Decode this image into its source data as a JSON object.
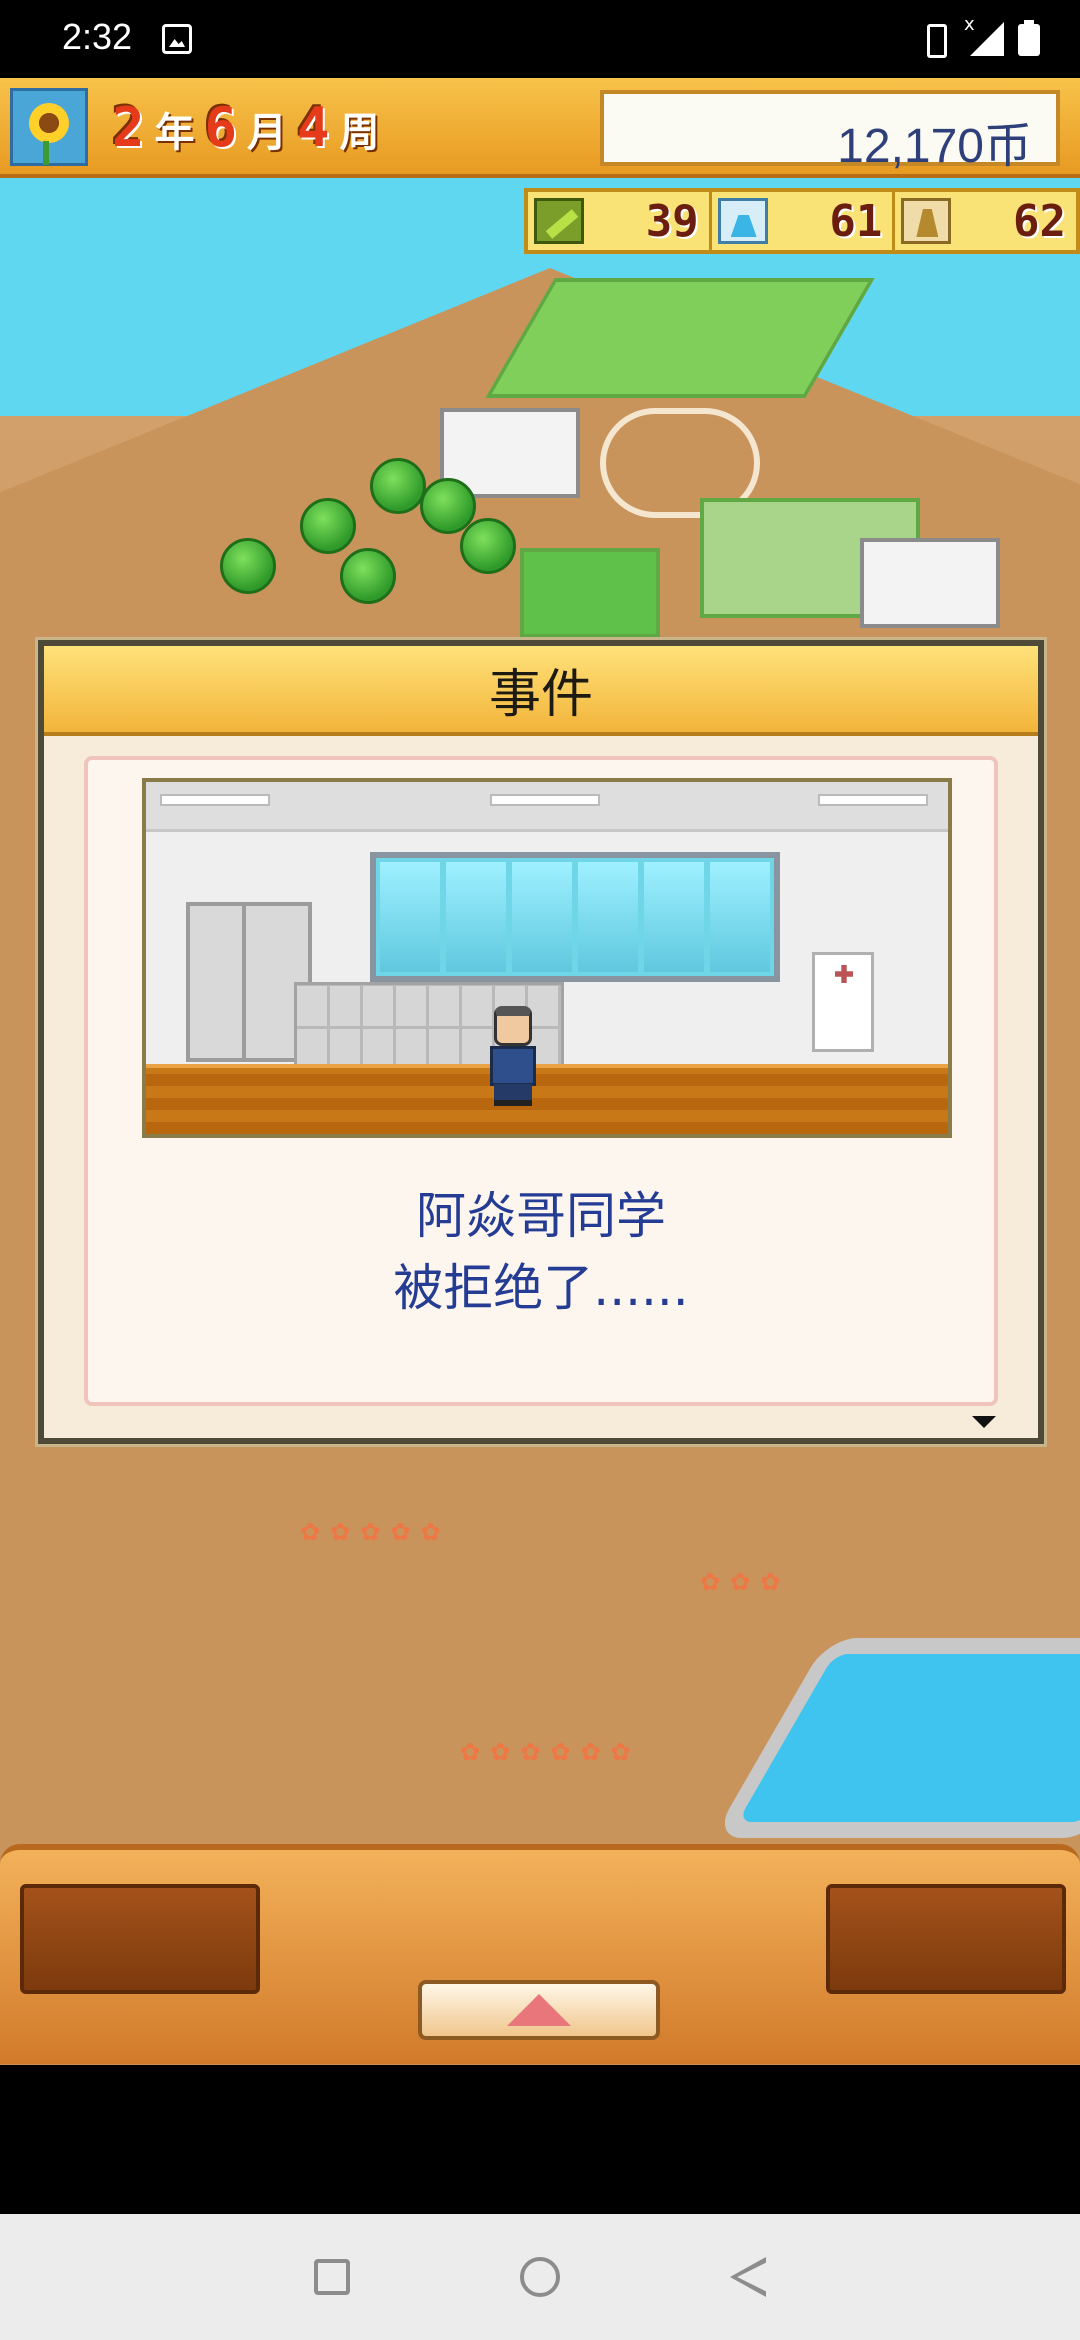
{
  "status_bar": {
    "time": "2:32",
    "icons": [
      "image-icon",
      "vibrate-icon",
      "signal-icon",
      "battery-icon"
    ]
  },
  "hud": {
    "date": {
      "year": "2",
      "year_unit": "年",
      "month": "6",
      "month_unit": "月",
      "week": "4",
      "week_unit": "周"
    },
    "money": "12,170币",
    "stats": [
      {
        "icon": "pencil-icon",
        "value": "39"
      },
      {
        "icon": "flask-icon",
        "value": "61"
      },
      {
        "icon": "bell-icon",
        "value": "62"
      }
    ]
  },
  "dialog": {
    "title": "事件",
    "message_line1": "阿焱哥同学",
    "message_line2": "被拒绝了......",
    "scene": "classroom-hallway"
  },
  "bottom_bar": {
    "up_button_icon": "triangle-up-icon"
  },
  "nav_bar": {
    "icons": [
      "recents-square-icon",
      "home-circle-icon",
      "back-triangle-icon"
    ]
  },
  "colors": {
    "hud_gold": "#f2b43a",
    "dialog_text": "#243c93",
    "sky": "#5fd7f0",
    "ground": "#c98f55"
  }
}
